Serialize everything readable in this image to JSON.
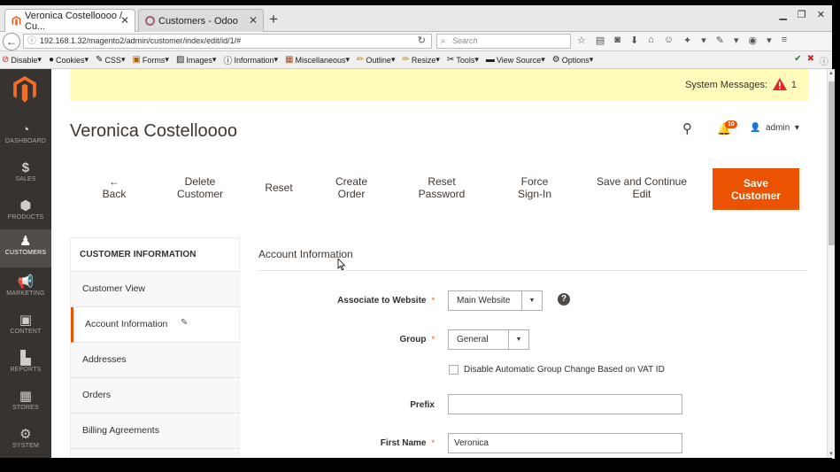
{
  "browser": {
    "tabs": [
      {
        "title": "Veronica Costelloooo / Cu...",
        "close": "✕"
      },
      {
        "title": "Customers - Odoo",
        "close": "✕"
      }
    ],
    "new_tab": "+",
    "url": "192.168.1.32/magento2/admin/customer/index/edit/id/1/#",
    "search_placeholder": "Search",
    "bookmarks": [
      "Disable",
      "Cookies",
      "CSS",
      "Forms",
      "Images",
      "Information",
      "Miscellaneous",
      "Outline",
      "Resize",
      "Tools",
      "View Source",
      "Options"
    ]
  },
  "sidebar": {
    "items": [
      {
        "label": "DASHBOARD",
        "icon": "dashboard-icon"
      },
      {
        "label": "SALES",
        "icon": "dollar-icon"
      },
      {
        "label": "PRODUCTS",
        "icon": "box-icon"
      },
      {
        "label": "CUSTOMERS",
        "icon": "person-icon"
      },
      {
        "label": "MARKETING",
        "icon": "megaphone-icon"
      },
      {
        "label": "CONTENT",
        "icon": "content-icon"
      },
      {
        "label": "REPORTS",
        "icon": "bar-chart-icon"
      },
      {
        "label": "STORES",
        "icon": "store-icon"
      },
      {
        "label": "SYSTEM",
        "icon": "gear-icon"
      }
    ]
  },
  "system_messages": {
    "label": "System Messages:",
    "count": "1"
  },
  "header": {
    "title": "Veronica Costelloooo",
    "notifications": "10",
    "user": "admin"
  },
  "actions": {
    "back": [
      "←",
      "Back"
    ],
    "delete": [
      "Delete",
      "Customer"
    ],
    "reset": "Reset",
    "create_order": [
      "Create",
      "Order"
    ],
    "reset_password": [
      "Reset",
      "Password"
    ],
    "force_signin": [
      "Force",
      "Sign-In"
    ],
    "save_continue": [
      "Save and Continue",
      "Edit"
    ],
    "save": [
      "Save",
      "Customer"
    ]
  },
  "customer_tabs": {
    "title": "CUSTOMER INFORMATION",
    "items": [
      "Customer View",
      "Account Information",
      "Addresses",
      "Orders",
      "Billing Agreements"
    ]
  },
  "form": {
    "section_title": "Account Information",
    "associate_label": "Associate to Website",
    "associate_value": "Main Website",
    "group_label": "Group",
    "group_value": "General",
    "disable_auto_group": "Disable Automatic Group Change Based on VAT ID",
    "prefix_label": "Prefix",
    "prefix_value": "",
    "firstname_label": "First Name",
    "firstname_value": "Veronica",
    "required_mark": "*",
    "help": "?"
  },
  "colors": {
    "accent": "#eb5202",
    "sidebar": "#373330",
    "message_bg": "#fffbbb"
  }
}
